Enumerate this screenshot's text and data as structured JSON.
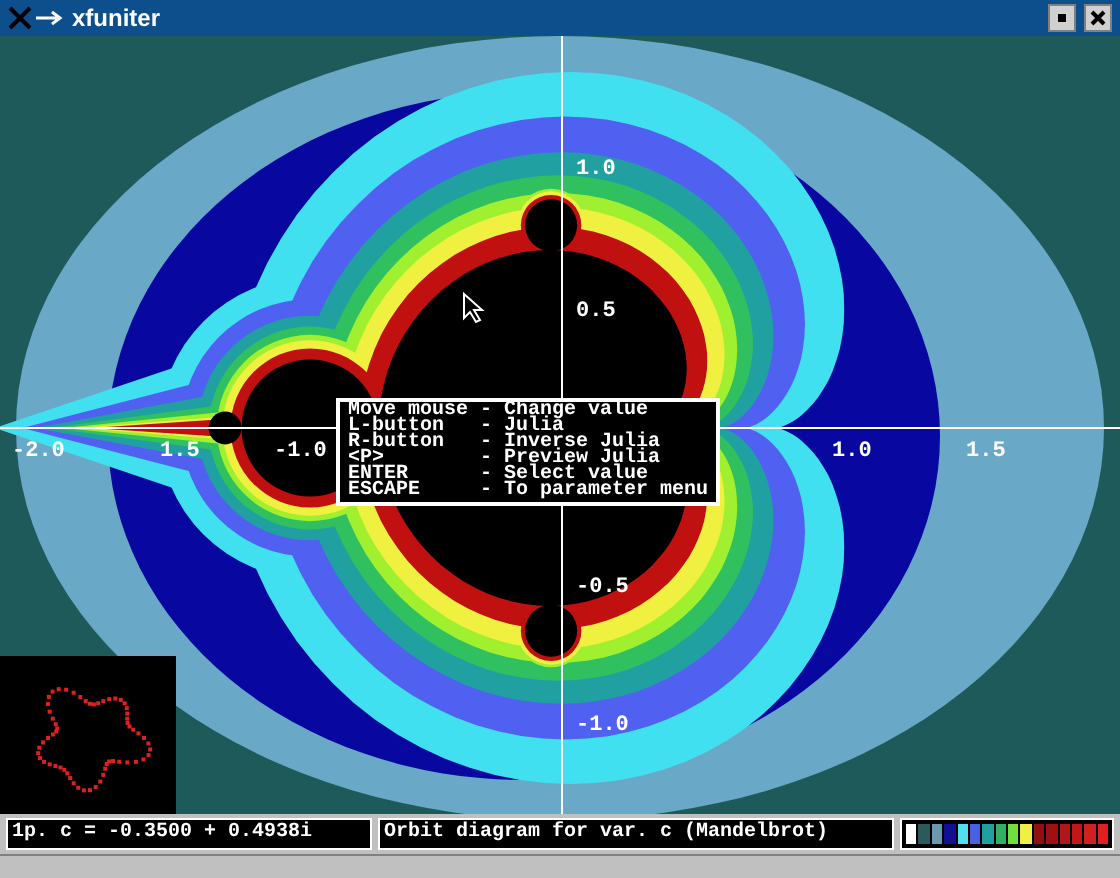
{
  "window": {
    "title": "xfuniter"
  },
  "plot": {
    "x_axis_labels": [
      "-2.0",
      "1.5",
      "-1.0",
      "1.0",
      "1.5"
    ],
    "y_axis_labels": [
      "1.0",
      "0.5",
      "-0.5",
      "-1.0"
    ]
  },
  "help_menu": [
    {
      "key": "Move mouse",
      "separator": "-",
      "action": "Change value"
    },
    {
      "key": "L-button",
      "separator": "-",
      "action": "Julia"
    },
    {
      "key": "R-button",
      "separator": "-",
      "action": "Inverse Julia"
    },
    {
      "key": "<P>",
      "separator": "-",
      "action": "Preview Julia"
    },
    {
      "key": "ENTER",
      "separator": "-",
      "action": "Select value"
    },
    {
      "key": "ESCAPE",
      "separator": "-",
      "action": "To parameter menu"
    }
  ],
  "status_bar": {
    "parameter": "1p. c = -0.3500 + 0.4938i",
    "mode": "Orbit diagram for var. c (Mandelbrot)",
    "palette": [
      {
        "color": "#ffffff"
      },
      {
        "color": "#2a5a5a"
      },
      {
        "color": "#6a9ab0"
      },
      {
        "color": "#101090"
      },
      {
        "color": "#50e0f0"
      },
      {
        "color": "#4a60e0"
      },
      {
        "color": "#20a0a0"
      },
      {
        "color": "#30b060"
      },
      {
        "color": "#70e040"
      },
      {
        "color": "#f0f040"
      },
      {
        "color": "#901010"
      },
      {
        "color": "#a01010"
      },
      {
        "color": "#b01818"
      },
      {
        "color": "#c01818"
      },
      {
        "color": "#d02020"
      },
      {
        "color": "#e02020"
      }
    ]
  }
}
